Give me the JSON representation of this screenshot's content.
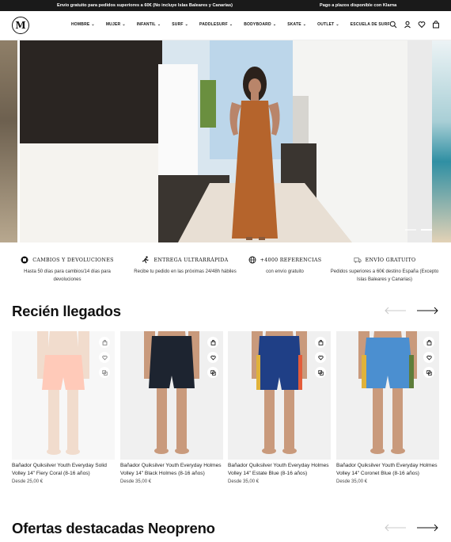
{
  "promo": {
    "left": "Envío gratuito para pedidos superiores a 60€ (No incluye Islas Baleares y Canarias)",
    "right": "Pago a plazos disponible con Klarna"
  },
  "header": {
    "logo_letter": "M",
    "nav": [
      {
        "label": "HOMBRE",
        "dropdown": true
      },
      {
        "label": "MUJER",
        "dropdown": true
      },
      {
        "label": "INFANTIL",
        "dropdown": true
      },
      {
        "label": "SURF",
        "dropdown": true
      },
      {
        "label": "PADDLESURF",
        "dropdown": true
      },
      {
        "label": "BODYBOARD",
        "dropdown": true
      },
      {
        "label": "SKATE",
        "dropdown": true
      },
      {
        "label": "OUTLET",
        "dropdown": true
      },
      {
        "label": "ESCUELA DE SURF",
        "dropdown": false
      }
    ],
    "icons": [
      "search-icon",
      "user-icon",
      "heart-icon",
      "bag-icon"
    ]
  },
  "hero": {
    "slides": 3,
    "active_slide": 2
  },
  "features": [
    {
      "title": "CAMBIOS Y DEVOLUCIONES",
      "subtitle": "Hasta 50 días para cambios/14 días para devoluciones",
      "icon": "box-icon"
    },
    {
      "title": "ENTREGA ULTRARRÁPIDA",
      "subtitle": "Recibe tu pedido en las próximas 24/48h hábiles",
      "icon": "runner-icon"
    },
    {
      "title": "+4000 REFERENCIAS",
      "subtitle": "con envío gratuito",
      "icon": "globe-icon"
    },
    {
      "title": "ENVÍO GRATUITO",
      "subtitle": "Pedidos superiores a 60€ destino España (Excepto Islas Baleares y Canarias)",
      "icon": "truck-icon"
    }
  ],
  "new_arrivals": {
    "title": "Recién llegados",
    "products": [
      {
        "name": "Bañador Quiksilver Youth Everyday Solid Volley 14\" Fiery Coral (8-16 años)",
        "price": "Desde 25,00 €",
        "color": "#ffb39a",
        "faded": true
      },
      {
        "name": "Bañador Quiksilver Youth Everyday Holmes Volley 14\" Black Holmes (8-16 años)",
        "price": "Desde 35,00 €",
        "color": "#1d2430",
        "faded": false
      },
      {
        "name": "Bañador Quiksilver Youth Everyday Holmes Volley 14\" Estate Blue (8-16 años)",
        "price": "Desde 35,00 €",
        "color": "#1f3f86",
        "faded": false
      },
      {
        "name": "Bañador Quiksilver Youth Everyday Holmes Volley 14\" Coronet Blue (8-16 años)",
        "price": "Desde 35,00 €",
        "color": "#4b8fd0",
        "faded": false
      }
    ]
  },
  "featured_offers": {
    "title": "Ofertas destacadas Neopreno"
  },
  "colors": {
    "promo_bg": "#1a1a1a",
    "accent": "#111111"
  }
}
